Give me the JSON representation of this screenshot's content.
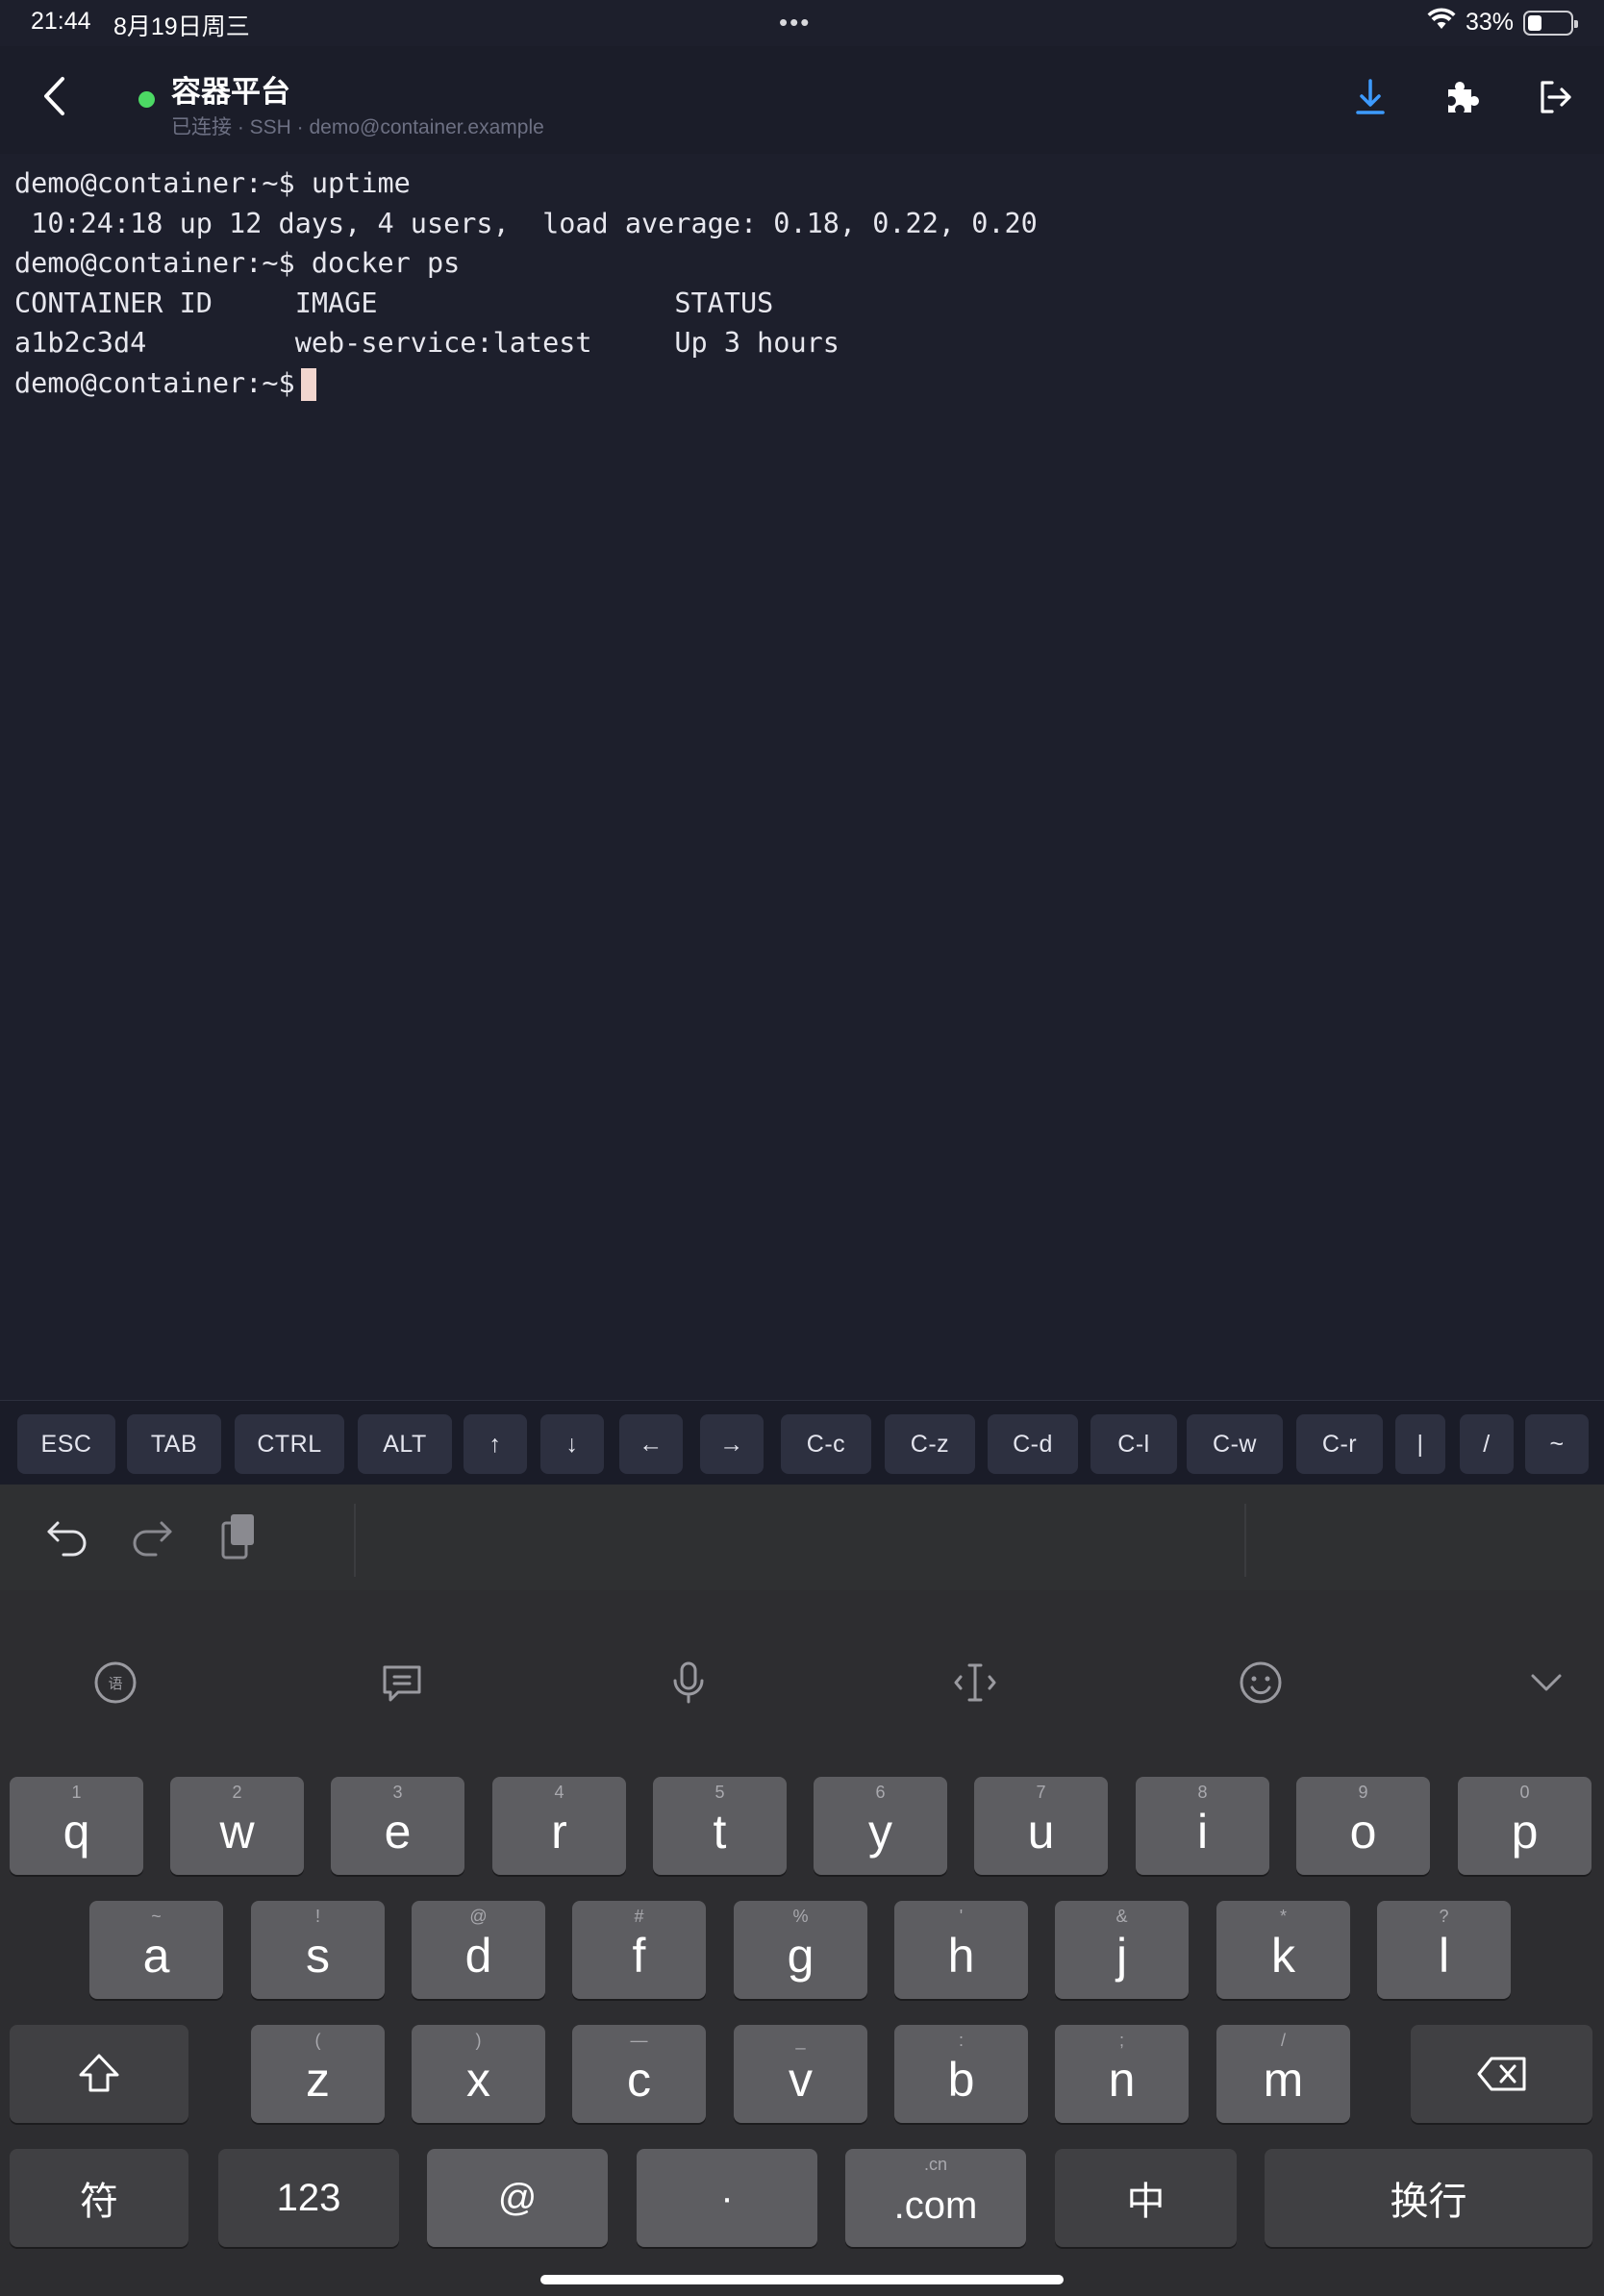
{
  "status_bar": {
    "time": "21:44",
    "date": "8月19日周三",
    "more": "•••",
    "battery": "33%",
    "battery_level": 0.33
  },
  "header": {
    "title": "容器平台",
    "subtitle": "已连接 · SSH · demo@container.example",
    "connection_color": "#4cd964",
    "icons": [
      "back-icon",
      "download-icon",
      "puzzle-icon",
      "exit-icon"
    ]
  },
  "terminal": {
    "lines": [
      "demo@container:~$ uptime",
      " 10:24:18 up 12 days, 4 users,  load average: 0.18, 0.22, 0.20",
      "demo@container:~$ docker ps",
      "CONTAINER ID     IMAGE                  STATUS",
      "a1b2c3d4         web-service:latest     Up 3 hours",
      "demo@container:~$"
    ],
    "cursor_color": "#f2d6cf"
  },
  "shortcuts": [
    "ESC",
    "TAB",
    "CTRL",
    "ALT",
    "↑",
    "↓",
    "←",
    "→",
    "C-c",
    "C-z",
    "C-d",
    "C-l",
    "C-w",
    "C-r",
    "|",
    "/",
    "~"
  ],
  "keyboard": {
    "toolbar_icons": [
      "undo-icon",
      "redo-icon",
      "clipboard-icon"
    ],
    "candidate_icons": [
      "voice-to-text-icon",
      "phrase-icon",
      "microphone-icon",
      "cursor-move-icon",
      "emoji-icon",
      "collapse-keyboard-icon"
    ],
    "row1": [
      {
        "hint": "1",
        "key": "q"
      },
      {
        "hint": "2",
        "key": "w"
      },
      {
        "hint": "3",
        "key": "e"
      },
      {
        "hint": "4",
        "key": "r"
      },
      {
        "hint": "5",
        "key": "t"
      },
      {
        "hint": "6",
        "key": "y"
      },
      {
        "hint": "7",
        "key": "u"
      },
      {
        "hint": "8",
        "key": "i"
      },
      {
        "hint": "9",
        "key": "o"
      },
      {
        "hint": "0",
        "key": "p"
      }
    ],
    "row2": [
      {
        "hint": "~",
        "key": "a"
      },
      {
        "hint": "!",
        "key": "s"
      },
      {
        "hint": "@",
        "key": "d"
      },
      {
        "hint": "#",
        "key": "f"
      },
      {
        "hint": "%",
        "key": "g"
      },
      {
        "hint": "'",
        "key": "h"
      },
      {
        "hint": "&",
        "key": "j"
      },
      {
        "hint": "*",
        "key": "k"
      },
      {
        "hint": "?",
        "key": "l"
      }
    ],
    "row3": [
      {
        "hint": "(",
        "key": "z"
      },
      {
        "hint": ")",
        "key": "x"
      },
      {
        "hint": "—",
        "key": "c"
      },
      {
        "hint": "_",
        "key": "v"
      },
      {
        "hint": ":",
        "key": "b"
      },
      {
        "hint": ";",
        "key": "n"
      },
      {
        "hint": "/",
        "key": "m"
      }
    ],
    "row4": {
      "symbol": "符",
      "numbers": "123",
      "at": "@",
      "dot": "·",
      "com_hint": ".cn",
      "com": ".com",
      "lang": "中",
      "enter": "换行"
    }
  }
}
